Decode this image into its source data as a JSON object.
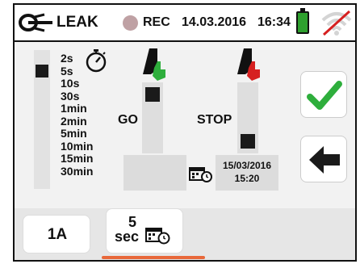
{
  "header": {
    "mode": "LEAK",
    "rec_label": "REC",
    "date": "14.03.2016",
    "time": "16:34",
    "icons": {
      "mode": "clamp-icon",
      "rec": "record-dot-icon",
      "battery": "battery-icon",
      "wifi": "wifi-off-icon"
    },
    "colors": {
      "battery": "#2ea02e",
      "wifi_slash": "#d62020"
    }
  },
  "durations": {
    "items": [
      "2s",
      "5s",
      "10s",
      "30s",
      "1min",
      "2min",
      "5min",
      "10min",
      "15min",
      "30min"
    ],
    "icon": "stopwatch-icon"
  },
  "go": {
    "label": "GO",
    "icon": "hand-green-icon",
    "color": "#2eae3c"
  },
  "stop": {
    "label": "STOP",
    "icon": "hand-red-icon",
    "color": "#d62020"
  },
  "schedule": {
    "date": "15/03/2016",
    "time": "15:20",
    "icon": "calendar-clock-icon"
  },
  "actions": {
    "confirm_icon": "checkmark-icon",
    "back_icon": "back-arrow-icon",
    "confirm_color": "#2eae3c"
  },
  "footer": {
    "tab1_label": "1A",
    "tab2_value": "5",
    "tab2_unit": "sec",
    "tab2_icon": "calendar-clock-icon",
    "active_underline_color": "#e8683a"
  }
}
